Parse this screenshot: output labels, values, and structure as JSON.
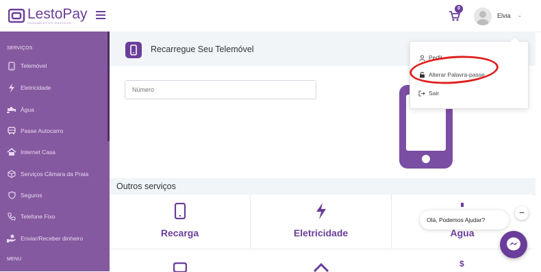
{
  "brand": {
    "name": "LestoPay",
    "tagline": "PAGAMENTOS RÁPIDOS",
    "color": "#6a3d9a"
  },
  "header": {
    "cart_count": "0",
    "user_name": "Elvia"
  },
  "sidebar": {
    "section_services": "SERVIÇOS",
    "items": [
      {
        "label": "Telemóvel",
        "icon": "phone-icon"
      },
      {
        "label": "Eletricidade",
        "icon": "bolt-icon"
      },
      {
        "label": "Água",
        "icon": "tap-icon"
      },
      {
        "label": "Passe Autocarro",
        "icon": "bus-icon"
      },
      {
        "label": "Internet Casa",
        "icon": "home-icon"
      },
      {
        "label": "Serviços Câmara da Praia",
        "icon": "cube-icon"
      },
      {
        "label": "Seguros",
        "icon": "shield-icon"
      },
      {
        "label": "Telefone Fixo",
        "icon": "landline-icon"
      },
      {
        "label": "Enviar/Receber dinheiro",
        "icon": "hand-money-icon"
      }
    ],
    "section_menu": "MENU"
  },
  "main": {
    "title": "Recarregue Seu Telemóvel",
    "number_placeholder": "Número",
    "others_title": "Outros serviços",
    "cards": [
      {
        "label": "Recarga",
        "icon": "phone-icon"
      },
      {
        "label": "Eletricidade",
        "icon": "bolt-icon"
      },
      {
        "label": "Água",
        "icon": "tap-icon"
      }
    ]
  },
  "user_menu": {
    "items": [
      {
        "label": "Perfil",
        "icon": "user-icon"
      },
      {
        "label": "Alterar Palavra-passe",
        "icon": "unlock-icon"
      },
      {
        "label": "Sair",
        "icon": "logout-icon"
      }
    ]
  },
  "chat": {
    "greeting": "Olá, Podemos Ajudar?",
    "close_label": "−"
  }
}
